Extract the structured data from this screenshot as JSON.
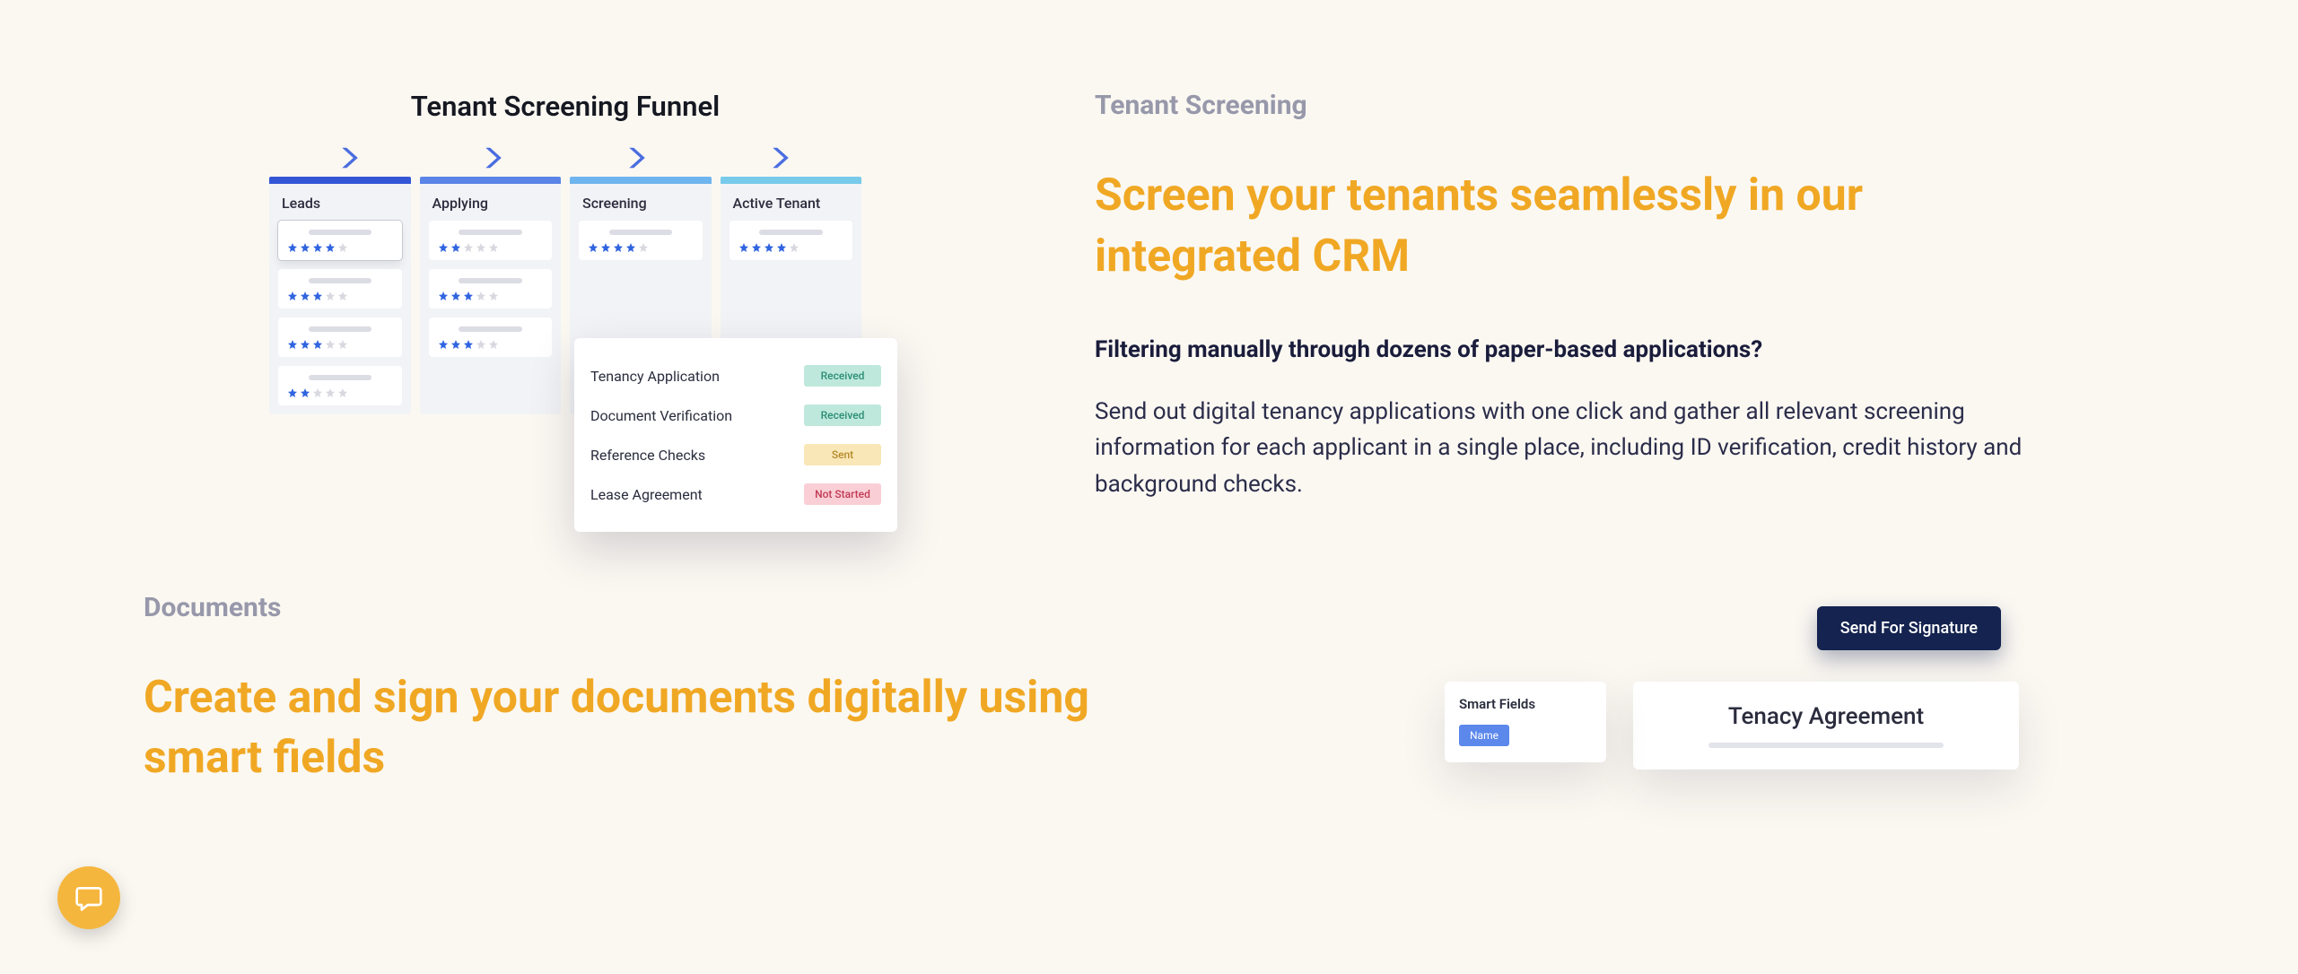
{
  "section1": {
    "eyebrow": "Tenant Screening",
    "headline": "Screen your tenants seamlessly in our integrated CRM",
    "subhead": "Filtering manually through dozens of paper-based applications?",
    "body": "Send out digital tenancy applications with one click and gather all relevant screening information for each applicant in a single place, including ID verification, credit history and background checks.",
    "funnel": {
      "title": "Tenant Screening Funnel",
      "columns": [
        {
          "label": "Leads",
          "barColor": "#3456d6",
          "cards": [
            {
              "stars": 4,
              "highlight": true
            },
            {
              "stars": 3
            },
            {
              "stars": 3
            },
            {
              "stars": 2
            }
          ]
        },
        {
          "label": "Applying",
          "barColor": "#5a84e7",
          "cards": [
            {
              "stars": 2
            },
            {
              "stars": 3
            },
            {
              "stars": 3
            }
          ]
        },
        {
          "label": "Screening",
          "barColor": "#6eb4ee",
          "cards": [
            {
              "stars": 4
            }
          ]
        },
        {
          "label": "Active Tenant",
          "barColor": "#78caea",
          "cards": [
            {
              "stars": 4
            }
          ]
        }
      ],
      "popup": [
        {
          "label": "Tenancy Application",
          "status": "Received",
          "class": "received"
        },
        {
          "label": "Document Verification",
          "status": "Received",
          "class": "received"
        },
        {
          "label": "Reference Checks",
          "status": "Sent",
          "class": "sent"
        },
        {
          "label": "Lease Agreement",
          "status": "Not Started",
          "class": "notstarted"
        }
      ]
    }
  },
  "section2": {
    "eyebrow": "Documents",
    "headline": "Create and sign your documents digitally using smart fields",
    "signButton": "Send For Signature",
    "docTitle": "Tenacy Agreement",
    "smartFieldsTitle": "Smart Fields",
    "smartField1": "Name"
  },
  "colors": {
    "accent": "#f0a824",
    "navy": "#1a1c3b",
    "chevron": "#4a6de0"
  }
}
